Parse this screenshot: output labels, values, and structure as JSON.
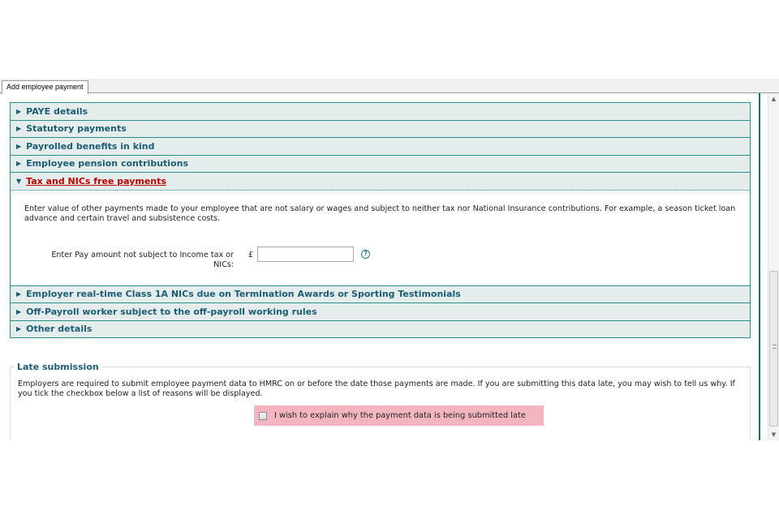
{
  "tabs": [
    {
      "label": "Add employee payment"
    }
  ],
  "accordion": {
    "sections_before": [
      {
        "label": "PAYE details"
      },
      {
        "label": "Statutory payments"
      },
      {
        "label": "Payrolled benefits in kind"
      },
      {
        "label": "Employee pension contributions"
      }
    ],
    "open_section": {
      "label": "Tax and NICs free payments",
      "description": "Enter value of other payments made to your employee that are not salary or wages and subject to neither tax nor National Insurance contributions. For example, a season ticket loan advance and certain travel and subsistence costs.",
      "field_label": "Enter Pay amount not subject to Income tax or NICs:",
      "currency_symbol": "£",
      "field_value": "",
      "help_icon": "?"
    },
    "sections_after": [
      {
        "label": "Employer real-time Class 1A NICs due on Termination Awards or Sporting Testimonials"
      },
      {
        "label": "Off-Payroll worker subject to the off-payroll working rules"
      },
      {
        "label": "Other details"
      }
    ]
  },
  "late_submission": {
    "title": "Late submission",
    "description": "Employers are required to submit employee payment data to HMRC on or before the date those payments are made. If you are submitting this data late, you may wish to tell us why. If you tick the checkbox below a list of reasons will be displayed.",
    "checkbox_label": "I wish to explain why the payment data is being submitted late",
    "checked": false
  },
  "icons": {
    "collapsed_arrow": "▶",
    "expanded_arrow": "▼",
    "scroll_up": "▲",
    "scroll_down": "▼"
  },
  "colors": {
    "accent": "#2b8c8c",
    "header_text": "#1c5d74",
    "active_header": "#c00000",
    "highlight": "#f3b6c0"
  }
}
